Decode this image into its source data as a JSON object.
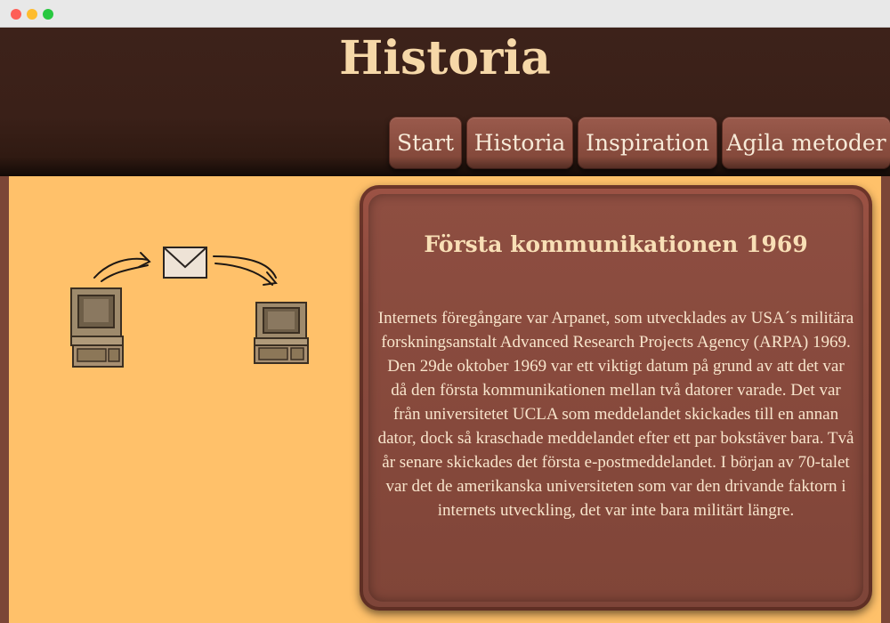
{
  "site": {
    "title": "Historia"
  },
  "nav": {
    "items": [
      {
        "label": "Start"
      },
      {
        "label": "Historia"
      },
      {
        "label": "Inspiration"
      },
      {
        "label": "Agila metoder"
      }
    ]
  },
  "article": {
    "title": "Första kommunikationen 1969",
    "body": "Internets föregångare var Arpanet, som utvecklades av USA´s militära forskningsanstalt Advanced Research Projects Agency (ARPA) 1969. Den 29de oktober 1969 var ett viktigt datum på grund av att det var då den första kommunikationen mellan två datorer varade. Det var från universitetet UCLA som meddelandet skickades till en annan dator, dock så kraschade meddelandet efter ett par bokstäver bara. Två år senare skickades det första e-postmeddelandet. I början av 70-talet var det de amerikanska universiteten som var den drivande faktorn i internets utveckling, det var inte bara militärt längre."
  },
  "colors": {
    "header": "#3d221a",
    "title": "#f6d8a8",
    "nav_button": "#8c4f42",
    "content_bg": "#ffc16a",
    "card_bg": "#8a4a3d",
    "card_text": "#f8e5cc"
  },
  "illustration": {
    "icons": [
      "computer-icon",
      "envelope-icon",
      "arrow-icon",
      "computer-icon"
    ]
  }
}
